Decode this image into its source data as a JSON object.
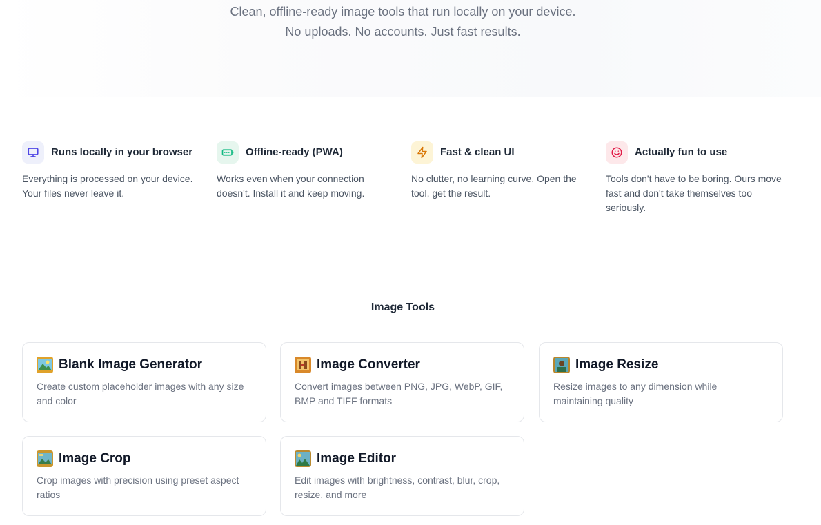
{
  "hero": {
    "subtitle_line1": "Clean, offline-ready image tools that run locally on your device.",
    "subtitle_line2": "No uploads. No accounts. Just fast results."
  },
  "features": [
    {
      "icon": "monitor-icon",
      "color": "#4f46e5",
      "bg": "#eef0fb",
      "title": "Runs locally in your browser",
      "description": "Everything is processed on your device. Your files never leave it."
    },
    {
      "icon": "battery-icon",
      "color": "#10b981",
      "bg": "#e6f6ee",
      "title": "Offline-ready (PWA)",
      "description": "Works even when your connection doesn't. Install it and keep moving."
    },
    {
      "icon": "lightning-icon",
      "color": "#d97706",
      "bg": "#fdf4d6",
      "title": "Fast & clean UI",
      "description": "No clutter, no learning curve. Open the tool, get the result."
    },
    {
      "icon": "smile-icon",
      "color": "#e11d48",
      "bg": "#fde8ea",
      "title": "Actually fun to use",
      "description": "Tools don't have to be boring. Ours move fast and don't take themselves too seriously."
    }
  ],
  "tools_section": {
    "title": "Image Tools"
  },
  "tools": [
    {
      "icon": "landscape-icon",
      "title": "Blank Image Generator",
      "description": "Create custom placeholder images with any size and color"
    },
    {
      "icon": "converter-icon",
      "title": "Image Converter",
      "description": "Convert images between PNG, JPG, WebP, GIF, BMP and TIFF formats"
    },
    {
      "icon": "resize-icon",
      "title": "Image Resize",
      "description": "Resize images to any dimension while maintaining quality"
    },
    {
      "icon": "crop-icon",
      "title": "Image Crop",
      "description": "Crop images with precision using preset aspect ratios"
    },
    {
      "icon": "editor-icon",
      "title": "Image Editor",
      "description": "Edit images with brightness, contrast, blur, crop, resize, and more"
    }
  ]
}
